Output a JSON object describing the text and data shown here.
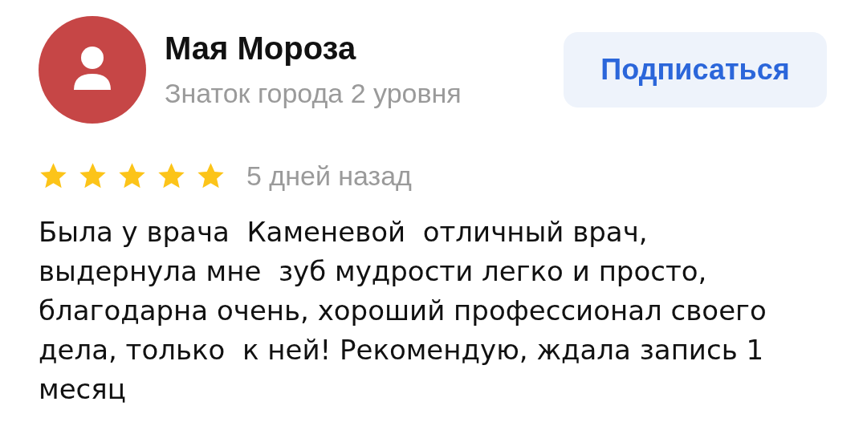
{
  "author": {
    "name": "Мая Мороза",
    "subtitle": "Знаток города 2 уровня"
  },
  "subscribe_button": {
    "label": "Подписаться"
  },
  "rating": {
    "stars": 5,
    "date": "5 дней назад"
  },
  "review": {
    "text": "Была у врача  Каменевой  отличный врач, выдернула мне  зуб мудрости легко и просто, благодарна очень, хороший профессионал своего дела, только  к ней! Рекомендую, ждала запись 1 месяц"
  }
}
